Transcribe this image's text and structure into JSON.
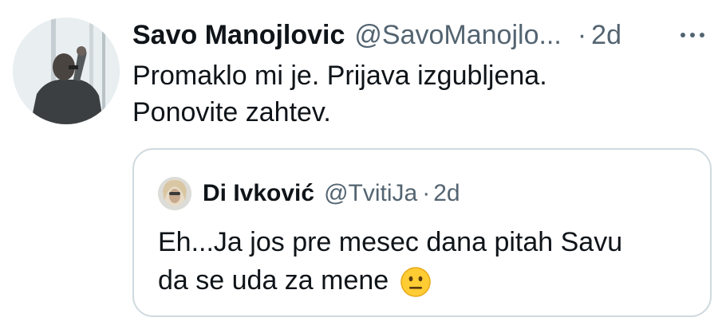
{
  "tweet": {
    "display_name": "Savo Manojlovic",
    "handle": "@SavoManojlo...",
    "separator": "·",
    "timestamp": "2d",
    "text_line1": "Promaklo mi je. Prijava izgubljena.",
    "text_line2": "Ponovite zahtev.",
    "avatar_icon": "user-avatar-photo",
    "more_icon": "more-horizontal-icon"
  },
  "quoted": {
    "display_name": "Di Ivković",
    "handle": "@TvitiJa",
    "separator": "·",
    "timestamp": "2d",
    "text_line1": "Eh...Ja jos pre mesec dana pitah Savu",
    "text_line2": "da se uda za mene",
    "emoji": "neutral-face-emoji",
    "avatar_icon": "user-avatar-photo"
  },
  "colors": {
    "text_primary": "#0f1419",
    "text_secondary": "#536471",
    "border": "#cfd9de",
    "emoji_yellow": "#ffcc33"
  }
}
